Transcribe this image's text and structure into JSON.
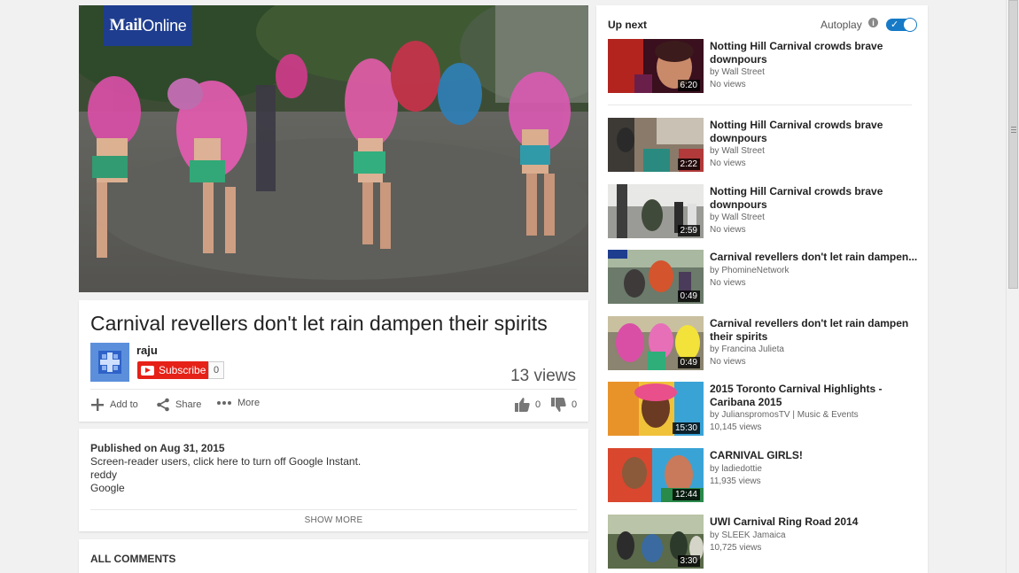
{
  "player": {
    "logo_bold": "Mail",
    "logo_light": "Online"
  },
  "video": {
    "title": "Carnival revellers don't let rain dampen their spirits",
    "channel": "raju",
    "subscribe_label": "Subscribe",
    "subscriber_count": "0",
    "views": "13 views",
    "actions": {
      "add_to": "Add to",
      "share": "Share",
      "more": "More",
      "likes": "0",
      "dislikes": "0"
    }
  },
  "description": {
    "published": "Published on Aug 31, 2015",
    "lines": [
      "Screen-reader users, click here to turn off Google Instant.",
      "reddy",
      "Google"
    ],
    "show_more": "SHOW MORE"
  },
  "comments": {
    "label": "ALL COMMENTS"
  },
  "sidebar": {
    "up_next": "Up next",
    "autoplay_label": "Autoplay",
    "autoplay_on": true,
    "accent": "#167ac6",
    "items": [
      {
        "title": "Notting Hill Carnival crowds brave downpours",
        "channel": "by Wall Street",
        "views": "No views",
        "duration": "6:20"
      },
      {
        "title": "Notting Hill Carnival crowds brave downpours",
        "channel": "by Wall Street",
        "views": "No views",
        "duration": "2:22"
      },
      {
        "title": "Notting Hill Carnival crowds brave downpours",
        "channel": "by Wall Street",
        "views": "No views",
        "duration": "2:59"
      },
      {
        "title": "Carnival revellers don't let rain dampen...",
        "channel": "by PhomineNetwork",
        "views": "No views",
        "duration": "0:49"
      },
      {
        "title": "Carnival revellers don't let rain dampen their spirits",
        "channel": "by Francina Julieta",
        "views": "No views",
        "duration": "0:49"
      },
      {
        "title": "2015 Toronto Carnival Highlights - Caribana 2015",
        "channel": "by JulianspromosTV | Music & Events",
        "views": "10,145 views",
        "duration": "15:30"
      },
      {
        "title": "CARNIVAL GIRLS!",
        "channel": "by ladiedottie",
        "views": "11,935 views",
        "duration": "12:44"
      },
      {
        "title": "UWI Carnival Ring Road 2014",
        "channel": "by SLEEK Jamaica",
        "views": "10,725 views",
        "duration": "3:30"
      }
    ]
  }
}
